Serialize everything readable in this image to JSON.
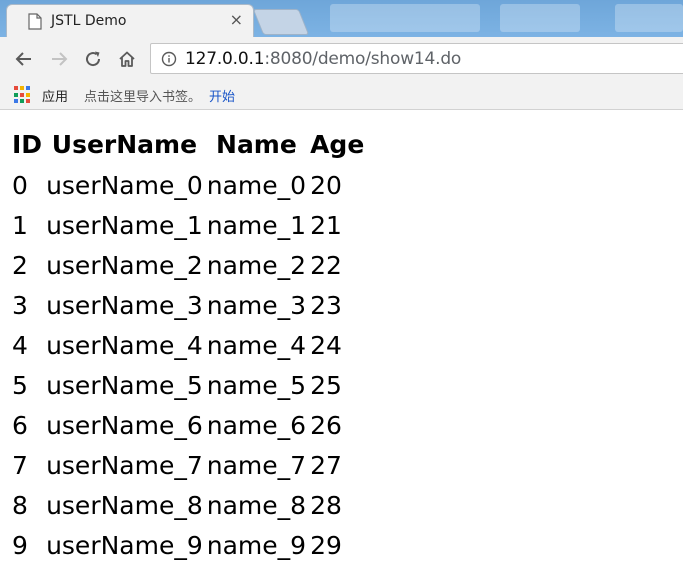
{
  "browser": {
    "tab_title": "JSTL Demo",
    "tab_close": "×",
    "url_host": "127.0.0.1",
    "url_rest": ":8080/demo/show14.do",
    "bookmarks": {
      "apps_label": "应用",
      "hint": "点击这里导入书签。",
      "start_link": "开始"
    },
    "icons": {
      "tab": "page-icon",
      "back": "back-arrow-icon",
      "forward": "forward-arrow-icon",
      "reload": "reload-icon",
      "home": "home-icon",
      "info": "info-icon",
      "apps": "apps-grid-icon"
    },
    "colors": {
      "titlebar": "#7db3e4",
      "toolbar": "#f2f2f2",
      "link": "#1a56c8"
    }
  },
  "table": {
    "headers": [
      "ID",
      "UserName",
      "Name",
      "Age"
    ],
    "rows": [
      [
        "0",
        "userName_0",
        "name_0",
        "20"
      ],
      [
        "1",
        "userName_1",
        "name_1",
        "21"
      ],
      [
        "2",
        "userName_2",
        "name_2",
        "22"
      ],
      [
        "3",
        "userName_3",
        "name_3",
        "23"
      ],
      [
        "4",
        "userName_4",
        "name_4",
        "24"
      ],
      [
        "5",
        "userName_5",
        "name_5",
        "25"
      ],
      [
        "6",
        "userName_6",
        "name_6",
        "26"
      ],
      [
        "7",
        "userName_7",
        "name_7",
        "27"
      ],
      [
        "8",
        "userName_8",
        "name_8",
        "28"
      ],
      [
        "9",
        "userName_9",
        "name_9",
        "29"
      ]
    ]
  }
}
